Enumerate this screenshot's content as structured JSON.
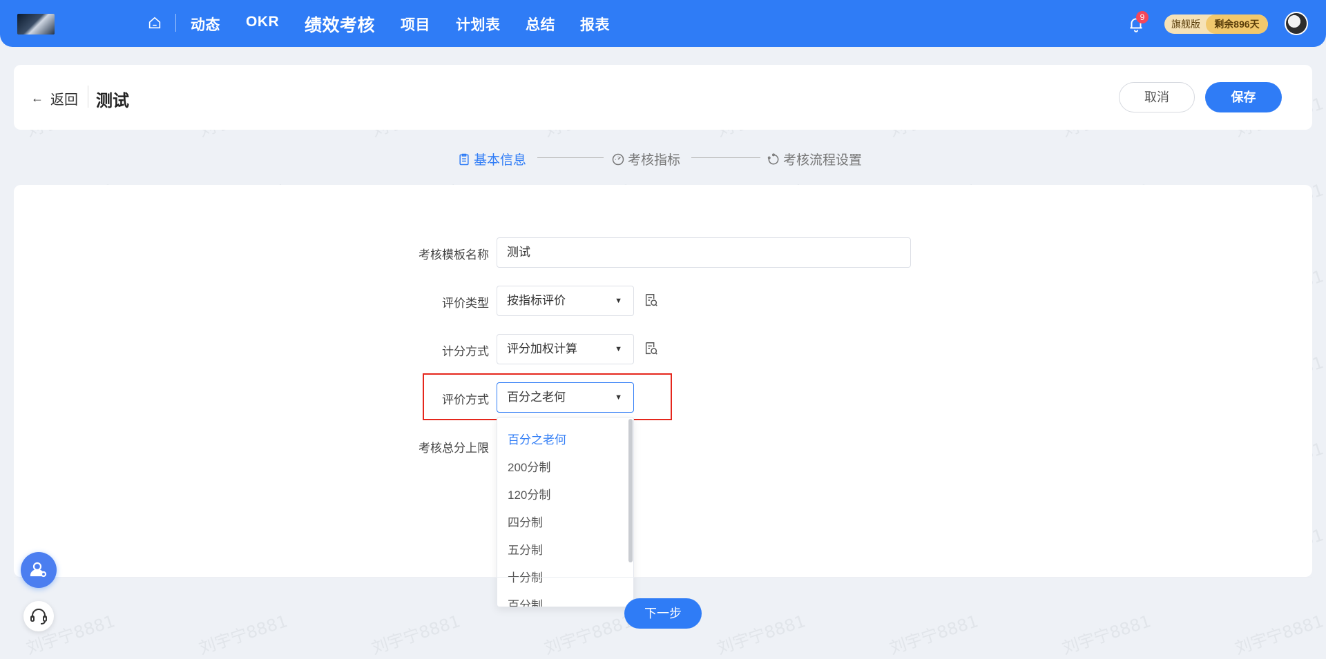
{
  "nav": {
    "items": [
      "动态",
      "OKR",
      "绩效考核",
      "项目",
      "计划表",
      "总结",
      "报表"
    ],
    "active_index": 2,
    "notification_count": "9",
    "plan_label": "旗舰版",
    "plan_remaining": "剩余896天"
  },
  "header": {
    "back_label": "返回",
    "title": "测试",
    "cancel_label": "取消",
    "save_label": "保存"
  },
  "steps": [
    {
      "label": "基本信息",
      "icon": "clipboard-icon",
      "active": true
    },
    {
      "label": "考核指标",
      "icon": "gauge-icon",
      "active": false
    },
    {
      "label": "考核流程设置",
      "icon": "cycle-icon",
      "active": false
    }
  ],
  "form": {
    "template_name_label": "考核模板名称",
    "template_name_value": "测试",
    "eval_type_label": "评价类型",
    "eval_type_value": "按指标评价",
    "scoring_method_label": "计分方式",
    "scoring_method_value": "评分加权计算",
    "eval_method_label": "评价方式",
    "eval_method_value": "百分之老何",
    "total_cap_label": "考核总分上限"
  },
  "dropdown": {
    "options": [
      "百分之老何",
      "200分制",
      "120分制",
      "四分制",
      "五分制",
      "十分制",
      "百分制"
    ],
    "selected_index": 0
  },
  "footer": {
    "next_label": "下一步"
  },
  "watermark": "刘宇宁8881",
  "colors": {
    "primary": "#2f7cf6",
    "highlight": "#e5261c",
    "badge": "#f5475a"
  }
}
